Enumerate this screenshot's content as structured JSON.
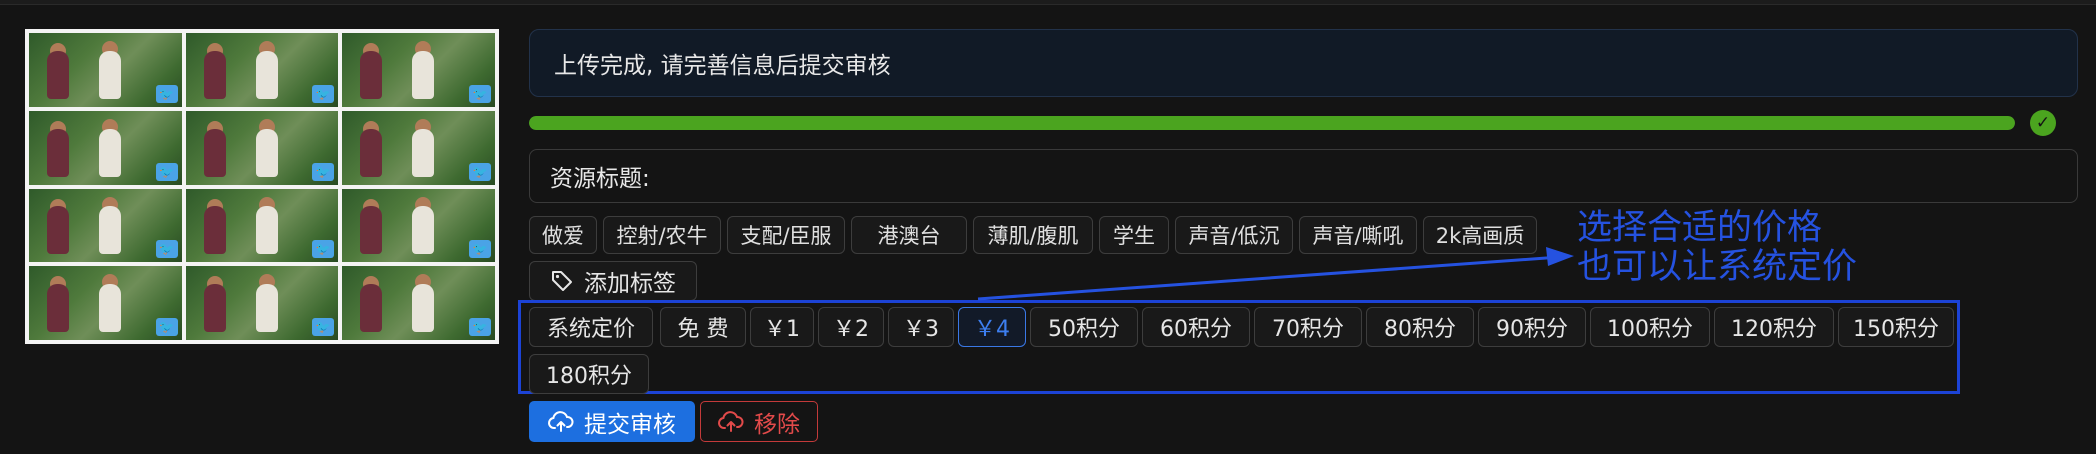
{
  "upload_message": "上传完成, 请完善信息后提交审核",
  "progress": {
    "percent": 100,
    "color": "#4ba41f"
  },
  "title_field": {
    "label": "资源标题:",
    "value": ""
  },
  "tags": [
    "做爱",
    "控射/农牛",
    "支配/臣服",
    "港澳台",
    "薄肌/腹肌",
    "学生",
    "声音/低沉",
    "声音/嘶吼",
    "2k高画质"
  ],
  "add_tag_label": "添加标签",
  "prices": [
    "系统定价",
    "免 费",
    "￥1",
    "￥2",
    "￥3",
    "￥4",
    "50积分",
    "60积分",
    "70积分",
    "80积分",
    "90积分",
    "100积分",
    "120积分",
    "150积分",
    "180积分"
  ],
  "selected_price": "￥4",
  "annotation": {
    "line1": "选择合适的价格",
    "line2": "也可以让系统定价",
    "color": "#2552e0"
  },
  "buttons": {
    "submit": "提交审核",
    "remove": "移除"
  },
  "colors": {
    "accent": "#1d6fe0",
    "danger": "#e24a4a",
    "success": "#4ba41f"
  },
  "thumbnails": {
    "rows": 4,
    "cols": 3,
    "badge_icon": "twitter-bird-icon"
  }
}
